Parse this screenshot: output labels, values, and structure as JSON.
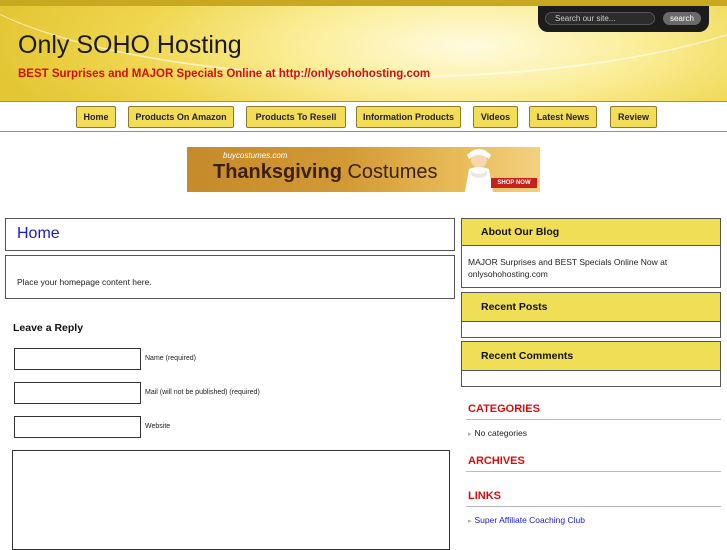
{
  "header": {
    "site_title": "Only SOHO Hosting",
    "tagline": "BEST Surprises and MAJOR Specials Online at http://onlysohohosting.com",
    "search_placeholder": "Search our site...",
    "search_button": "search"
  },
  "nav": {
    "items": [
      "Home",
      "Products On Amazon",
      "Products To Resell",
      "Information Products",
      "Videos",
      "Latest News",
      "Review"
    ]
  },
  "banner": {
    "brand": "buycostumes.com",
    "title_bold": "Thanksgiving",
    "title_rest": " Costumes",
    "cta": "SHOP NOW"
  },
  "main": {
    "page_title": "Home",
    "content": "Place your homepage content here.",
    "reply_title": "Leave a Reply",
    "fields": [
      {
        "label": "Name (required)"
      },
      {
        "label": "Mail (will not be published) (required)"
      },
      {
        "label": "Website"
      }
    ]
  },
  "sidebar": {
    "about_title": "About Our Blog",
    "about_text": "MAJOR Surprises and BEST Specials Online Now at onlysohohosting.com",
    "recent_posts_title": "Recent Posts",
    "recent_comments_title": "Recent Comments",
    "categories_title": "CATEGORIES",
    "categories_item": "No categories",
    "archives_title": "ARCHIVES",
    "links_title": "LINKS",
    "links_item": "Super Affiliate Coaching Club"
  },
  "colors": {
    "accent_yellow": "#f1de57",
    "title_red": "#d01010",
    "link_blue": "#1a1acc"
  }
}
